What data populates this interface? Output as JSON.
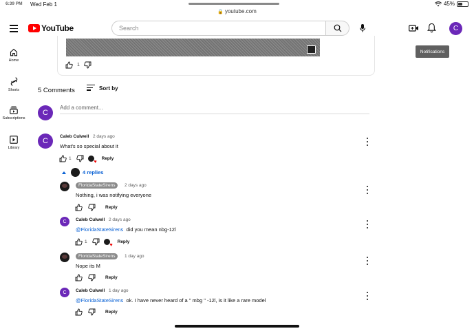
{
  "status": {
    "time": "6:39 PM",
    "date": "Wed Feb 1",
    "battery": "45%",
    "battery_level": 0.45,
    "url": "youtube.com"
  },
  "header": {
    "logo_text": "YouTube",
    "search_placeholder": "Search",
    "avatar_letter": "C"
  },
  "tooltip": "Notifications",
  "sidebar": {
    "items": [
      {
        "label": "Home"
      },
      {
        "label": "Shorts"
      },
      {
        "label": "Subscriptions"
      },
      {
        "label": "Library"
      }
    ]
  },
  "post": {
    "likes": "1"
  },
  "comments_section": {
    "count_label": "5 Comments",
    "sort_label": "Sort by",
    "add_placeholder": "Add a comment...",
    "avatar_letter": "C"
  },
  "comments": [
    {
      "author": "Caleb Culwell",
      "time": "2 days ago",
      "text": "What's so special about it",
      "likes": "1",
      "reply": "Reply",
      "avatar_letter": "C"
    }
  ],
  "replies_toggle": "4 replies",
  "replies": [
    {
      "author": "FloridaStateSirens",
      "time": "2 days ago",
      "text": "Nothing, i was notifying everyone",
      "reply": "Reply"
    },
    {
      "author": "Caleb Culwell",
      "time": "2 days ago",
      "mention": "@FloridaStateSirens",
      "text": "did you mean nbg-12l",
      "likes": "1",
      "reply": "Reply",
      "avatar_letter": "C"
    },
    {
      "author": "FloridaStateSirens",
      "time": "1 day ago",
      "text": "Nope its M",
      "reply": "Reply"
    },
    {
      "author": "Caleb Culwell",
      "time": "1 day ago",
      "mention": "@FloridaStateSirens",
      "text": "ok. I have never heard of a \" mbg \" -12l, is it like a rare model",
      "reply": "Reply",
      "avatar_letter": "C"
    }
  ]
}
